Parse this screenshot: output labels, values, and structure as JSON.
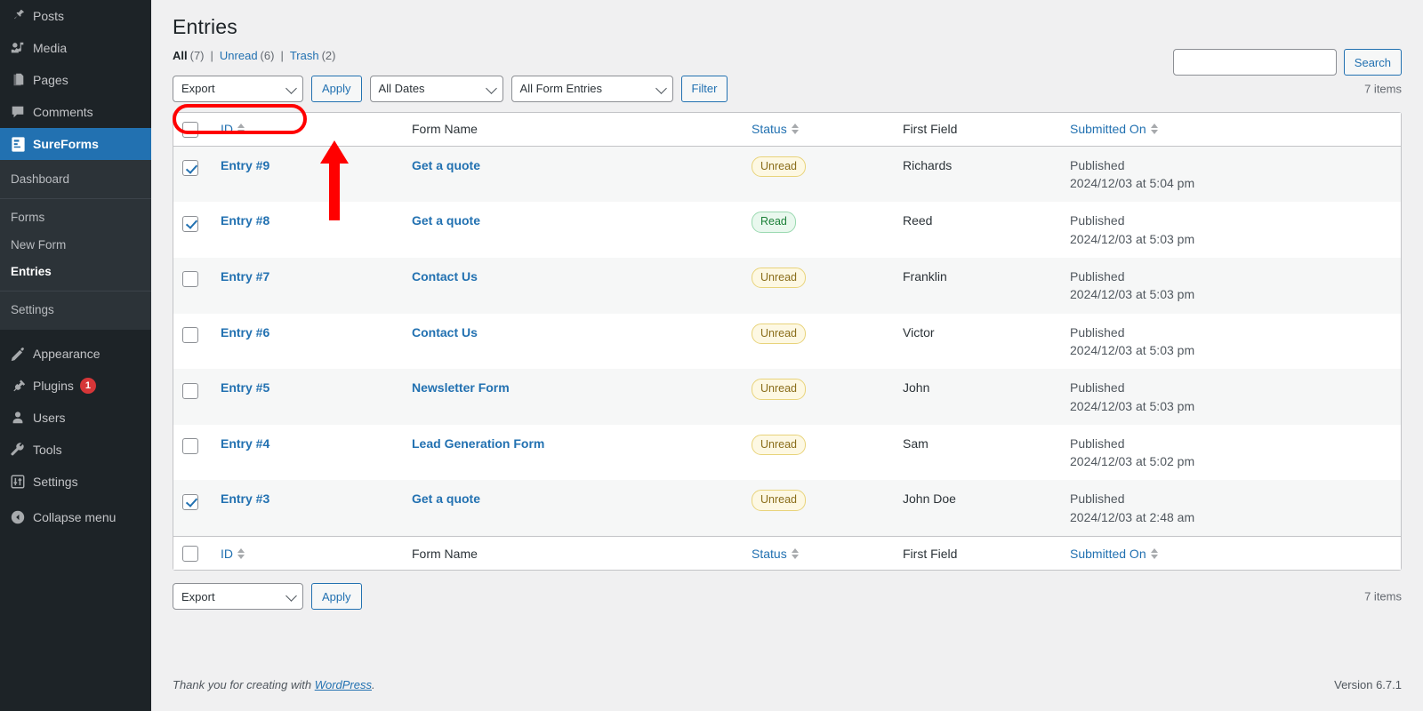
{
  "sidebar": {
    "items": [
      {
        "label": "Posts",
        "icon": "pushpin-icon",
        "name": "posts"
      },
      {
        "label": "Media",
        "icon": "media-icon",
        "name": "media"
      },
      {
        "label": "Pages",
        "icon": "pages-icon",
        "name": "pages"
      },
      {
        "label": "Comments",
        "icon": "comment-icon",
        "name": "comments"
      },
      {
        "label": "SureForms",
        "icon": "sureforms-icon",
        "name": "sureforms",
        "active": true
      }
    ],
    "submenu": [
      {
        "label": "Dashboard",
        "name": "dashboard"
      },
      {
        "label": "Forms",
        "name": "forms"
      },
      {
        "label": "New Form",
        "name": "new-form"
      },
      {
        "label": "Entries",
        "name": "entries",
        "current": true
      },
      {
        "label": "Settings",
        "name": "settings"
      }
    ],
    "lower_items": [
      {
        "label": "Appearance",
        "icon": "paintbrush-icon",
        "name": "appearance"
      },
      {
        "label": "Plugins",
        "icon": "plug-icon",
        "name": "plugins",
        "badge": "1"
      },
      {
        "label": "Users",
        "icon": "user-icon",
        "name": "users"
      },
      {
        "label": "Tools",
        "icon": "wrench-icon",
        "name": "tools"
      },
      {
        "label": "Settings",
        "icon": "sliders-icon",
        "name": "settings-main"
      }
    ],
    "collapse": {
      "label": "Collapse menu",
      "icon": "collapse-arrow-icon"
    }
  },
  "header": {
    "title": "Entries",
    "views": {
      "all_label": "All",
      "all_count": "(7)",
      "unread_label": "Unread",
      "unread_count": "(6)",
      "trash_label": "Trash",
      "trash_count": "(2)",
      "separator": "|"
    }
  },
  "search": {
    "value": "",
    "placeholder": "",
    "button_label": "Search"
  },
  "toolbar": {
    "bulk_action": "Export",
    "apply_label": "Apply",
    "date_filter": "All Dates",
    "form_filter": "All Form Entries",
    "filter_label": "Filter",
    "items_count": "7 items"
  },
  "toolbar_bottom": {
    "bulk_action": "Export",
    "apply_label": "Apply",
    "items_count": "7 items"
  },
  "table": {
    "columns": {
      "id": "ID",
      "form_name": "Form Name",
      "status": "Status",
      "first_field": "First Field",
      "submitted_on": "Submitted On"
    },
    "rows": [
      {
        "id": "Entry #9",
        "form_name": "Get a quote",
        "status": "Unread",
        "status_kind": "unread",
        "first_field": "Richards",
        "published": "Published",
        "date": "2024/12/03 at 5:04 pm",
        "checked": true
      },
      {
        "id": "Entry #8",
        "form_name": "Get a quote",
        "status": "Read",
        "status_kind": "read",
        "first_field": "Reed",
        "published": "Published",
        "date": "2024/12/03 at 5:03 pm",
        "checked": true
      },
      {
        "id": "Entry #7",
        "form_name": "Contact Us",
        "status": "Unread",
        "status_kind": "unread",
        "first_field": "Franklin",
        "published": "Published",
        "date": "2024/12/03 at 5:03 pm",
        "checked": false
      },
      {
        "id": "Entry #6",
        "form_name": "Contact Us",
        "status": "Unread",
        "status_kind": "unread",
        "first_field": "Victor",
        "published": "Published",
        "date": "2024/12/03 at 5:03 pm",
        "checked": false
      },
      {
        "id": "Entry #5",
        "form_name": "Newsletter Form",
        "status": "Unread",
        "status_kind": "unread",
        "first_field": "John",
        "published": "Published",
        "date": "2024/12/03 at 5:03 pm",
        "checked": false
      },
      {
        "id": "Entry #4",
        "form_name": "Lead Generation Form",
        "status": "Unread",
        "status_kind": "unread",
        "first_field": "Sam",
        "published": "Published",
        "date": "2024/12/03 at 5:02 pm",
        "checked": false
      },
      {
        "id": "Entry #3",
        "form_name": "Get a quote",
        "status": "Unread",
        "status_kind": "unread",
        "first_field": "John Doe",
        "published": "Published",
        "date": "2024/12/03 at 2:48 am",
        "checked": true
      }
    ]
  },
  "footer": {
    "thanks_prefix": "Thank you for creating with ",
    "wordpress_link": "WordPress",
    "thanks_suffix": ".",
    "version": "Version 6.7.1"
  },
  "annotations": {
    "highlight_color": "#ff0000",
    "highlight_target": "Export dropdown",
    "arrow_target": "Apply button"
  },
  "colors": {
    "sidebar_bg": "#1d2327",
    "submenu_bg": "#2c3338",
    "accent": "#2271b1",
    "page_bg": "#f0f0f1",
    "unread_badge": "#fdf8e3",
    "read_badge": "#e9f8ee",
    "plugin_badge": "#d63638"
  }
}
